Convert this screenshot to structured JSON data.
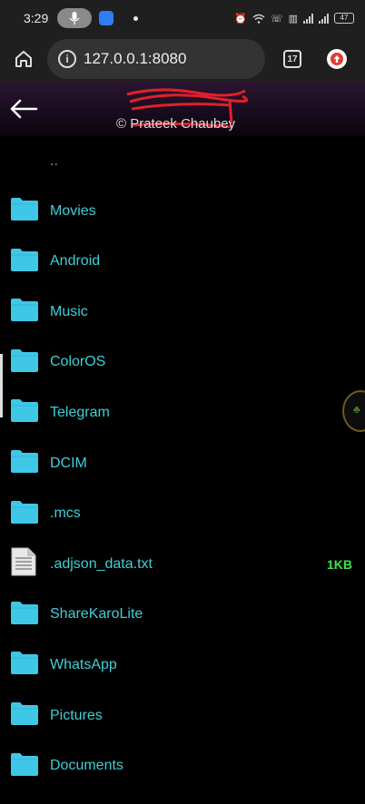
{
  "status_bar": {
    "time": "3:29",
    "battery": "47"
  },
  "browser": {
    "url": "127.0.0.1:8080",
    "tab_count": "17"
  },
  "header": {
    "copyright": "© Prateek Chaubey"
  },
  "file_list": {
    "parent": "..",
    "items": [
      {
        "name": "Movies",
        "type": "folder",
        "size": ""
      },
      {
        "name": "Android",
        "type": "folder",
        "size": ""
      },
      {
        "name": "Music",
        "type": "folder",
        "size": ""
      },
      {
        "name": "ColorOS",
        "type": "folder",
        "size": ""
      },
      {
        "name": "Telegram",
        "type": "folder",
        "size": ""
      },
      {
        "name": "DCIM",
        "type": "folder",
        "size": ""
      },
      {
        "name": ".mcs",
        "type": "folder",
        "size": ""
      },
      {
        "name": ".adjson_data.txt",
        "type": "file",
        "size": "1KB"
      },
      {
        "name": "ShareKaroLite",
        "type": "folder",
        "size": ""
      },
      {
        "name": "WhatsApp",
        "type": "folder",
        "size": ""
      },
      {
        "name": "Pictures",
        "type": "folder",
        "size": ""
      },
      {
        "name": "Documents",
        "type": "folder",
        "size": ""
      }
    ]
  },
  "colors": {
    "folder": "#3fc7e8",
    "file_name": "#3fcfd8",
    "file_size": "#3ee24a",
    "background": "#000000"
  },
  "icons": {
    "folder": "folder-icon",
    "file": "text-file-icon",
    "back": "arrow-left-icon",
    "home": "home-icon",
    "info": "info-icon"
  }
}
